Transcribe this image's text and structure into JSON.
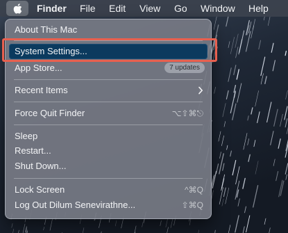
{
  "menubar": {
    "apple_icon": "apple-logo-icon",
    "items": [
      "Finder",
      "File",
      "Edit",
      "View",
      "Go",
      "Window",
      "Help"
    ]
  },
  "apple_menu": {
    "about": "About This Mac",
    "system_settings": "System Settings...",
    "app_store": "App Store...",
    "app_store_badge": "7 updates",
    "recent_items": "Recent Items",
    "force_quit": "Force Quit Finder",
    "force_quit_shortcut": "⌥⇧⌘⎋",
    "sleep": "Sleep",
    "restart": "Restart...",
    "shut_down": "Shut Down...",
    "lock_screen": "Lock Screen",
    "lock_screen_shortcut": "^⌘Q",
    "log_out": "Log Out Dilum Senevirathne...",
    "log_out_shortcut": "⇧⌘Q"
  },
  "colors": {
    "annotation_border": "#e8604f",
    "selection": "#0b3a5e",
    "menu_background": "#767a84"
  }
}
